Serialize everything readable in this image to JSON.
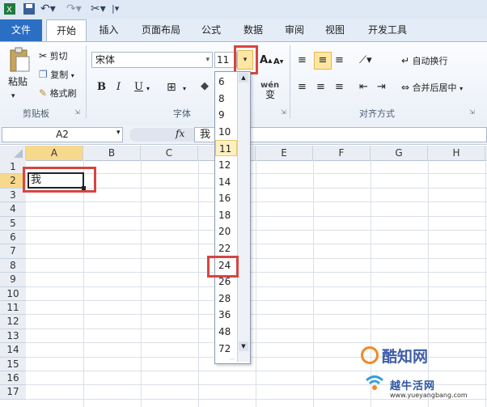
{
  "tabs": {
    "file": "文件",
    "home": "开始",
    "insert": "插入",
    "page_layout": "页面布局",
    "formulas": "公式",
    "data": "数据",
    "review": "审阅",
    "view": "视图",
    "developer": "开发工具"
  },
  "clipboard": {
    "paste": "粘贴",
    "cut": "剪切",
    "copy": "复制",
    "format_painter": "格式刷",
    "group_label": "剪贴板"
  },
  "font": {
    "name": "宋体",
    "size": "11",
    "bold": "B",
    "italic": "I",
    "underline": "U",
    "grow": "A",
    "shrink": "A",
    "group_label": "字体"
  },
  "alignment": {
    "wrap_text": "自动换行",
    "merge_center": "合并后居中",
    "group_label": "对齐方式"
  },
  "formula_bar": {
    "name_box": "A2",
    "fx": "fx",
    "content": "我"
  },
  "columns": [
    "A",
    "B",
    "C",
    "D",
    "E",
    "F",
    "G",
    "H"
  ],
  "rows": [
    "1",
    "2",
    "3",
    "4",
    "5",
    "6",
    "7",
    "8",
    "9",
    "10",
    "11",
    "12",
    "13",
    "14",
    "15",
    "16",
    "17"
  ],
  "cell_a2": "我",
  "font_size_options": [
    "6",
    "8",
    "9",
    "10",
    "11",
    "12",
    "14",
    "16",
    "18",
    "20",
    "22",
    "24",
    "26",
    "28",
    "36",
    "48",
    "72"
  ],
  "selected_font_size": "11",
  "highlighted_option": "24",
  "watermark": {
    "brand": "酷知网",
    "site_name": "越牛活网",
    "url": "www.yueyangbang.com"
  },
  "colors": {
    "file_tab": "#2b6fc4",
    "highlight_red": "#d64541",
    "selection_yellow": "#ffe7a3"
  }
}
